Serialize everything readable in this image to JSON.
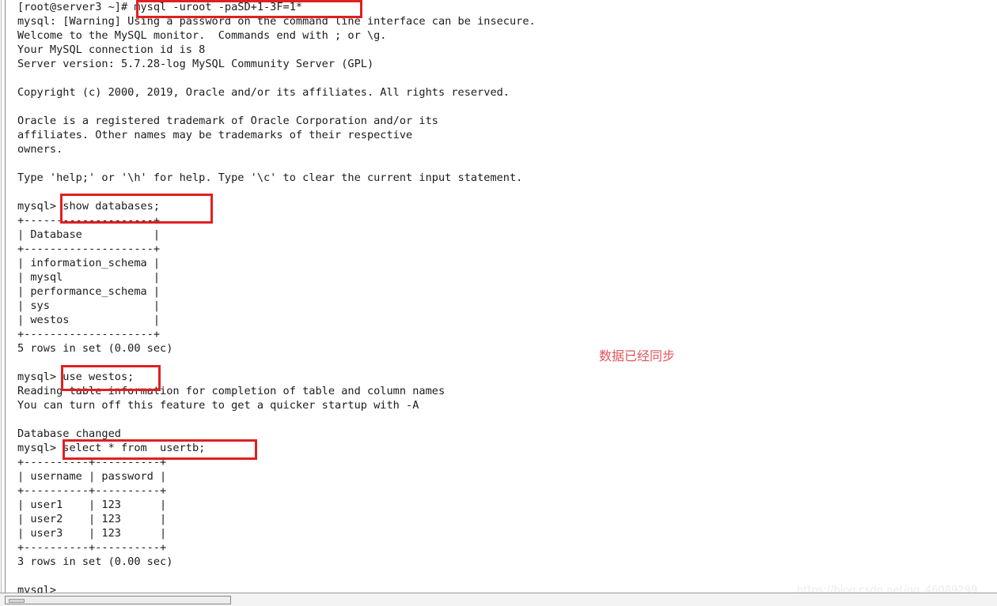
{
  "window": {
    "title_bar_visible": false,
    "accent_color": "#5b7f97"
  },
  "terminal": {
    "prompt_host": "[root@server3 ~]#",
    "mysql_prompt": "mysql>",
    "lines": [
      "[root@server3 ~]# mysql -uroot -paSD+1-3F=1*",
      "mysql: [Warning] Using a password on the command line interface can be insecure.",
      "Welcome to the MySQL monitor.  Commands end with ; or \\g.",
      "Your MySQL connection id is 8",
      "Server version: 5.7.28-log MySQL Community Server (GPL)",
      "",
      "Copyright (c) 2000, 2019, Oracle and/or its affiliates. All rights reserved.",
      "",
      "Oracle is a registered trademark of Oracle Corporation and/or its",
      "affiliates. Other names may be trademarks of their respective",
      "owners.",
      "",
      "Type 'help;' or '\\h' for help. Type '\\c' to clear the current input statement.",
      "",
      "mysql> show databases;",
      "+--------------------+",
      "| Database           |",
      "+--------------------+",
      "| information_schema |",
      "| mysql              |",
      "| performance_schema |",
      "| sys                |",
      "| westos             |",
      "+--------------------+",
      "5 rows in set (0.00 sec)",
      "",
      "mysql> use westos;",
      "Reading table information for completion of table and column names",
      "You can turn off this feature to get a quicker startup with -A",
      "",
      "Database changed",
      "mysql> select * from  usertb;",
      "+----------+----------+",
      "| username | password |",
      "+----------+----------+",
      "| user1    | 123      |",
      "| user2    | 123      |",
      "| user3    | 123      |",
      "+----------+----------+",
      "3 rows in set (0.00 sec)",
      "",
      "mysql>"
    ],
    "commands": {
      "login": "mysql -uroot -paSD+1-3F=1*",
      "show_databases": "show databases;",
      "use_database": "use westos;",
      "select_users": "select * from  usertb;"
    },
    "databases_table": {
      "columns": [
        "Database"
      ],
      "rows": [
        [
          "information_schema"
        ],
        [
          "mysql"
        ],
        [
          "performance_schema"
        ],
        [
          "sys"
        ],
        [
          "westos"
        ]
      ],
      "footer": "5 rows in set (0.00 sec)"
    },
    "usertb_table": {
      "columns": [
        "username",
        "password"
      ],
      "rows": [
        [
          "user1",
          "123"
        ],
        [
          "user2",
          "123"
        ],
        [
          "user3",
          "123"
        ]
      ],
      "footer": "3 rows in set (0.00 sec)"
    },
    "server_version": "5.7.28-log MySQL Community Server (GPL)",
    "connection_id": "8"
  },
  "annotations": {
    "sync_note": "数据已经同步",
    "sync_note_color": "#e0555c",
    "highlight_color": "#e02020",
    "boxes": [
      {
        "name": "login-command",
        "label": "mysql -uroot -paSD+1-3F=1*"
      },
      {
        "name": "show-databases-command",
        "label": "show databases;"
      },
      {
        "name": "use-westos-command",
        "label": "use westos;"
      },
      {
        "name": "select-usertb-command",
        "label": "select * from  usertb;"
      }
    ]
  },
  "watermark": {
    "text": "https://blog.csdn.net/qq_46089299"
  }
}
